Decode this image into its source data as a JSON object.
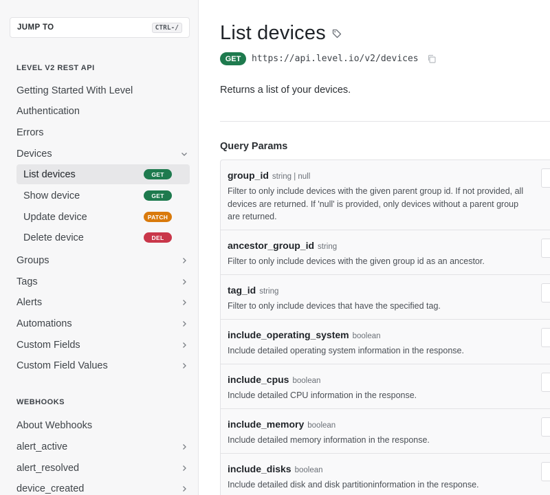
{
  "sidebar": {
    "jump_label": "JUMP TO",
    "jump_shortcut": "CTRL-/",
    "sections": [
      {
        "title": "LEVEL V2 REST API",
        "items": [
          {
            "label": "Getting Started With Level"
          },
          {
            "label": "Authentication"
          },
          {
            "label": "Errors"
          },
          {
            "label": "Devices",
            "expanded": true
          },
          {
            "label": "List devices",
            "method": "GET",
            "active": true
          },
          {
            "label": "Show device",
            "method": "GET"
          },
          {
            "label": "Update device",
            "method": "PATCH"
          },
          {
            "label": "Delete device",
            "method": "DEL"
          },
          {
            "label": "Groups"
          },
          {
            "label": "Tags"
          },
          {
            "label": "Alerts"
          },
          {
            "label": "Automations"
          },
          {
            "label": "Custom Fields"
          },
          {
            "label": "Custom Field Values"
          }
        ]
      },
      {
        "title": "WEBHOOKS",
        "items": [
          {
            "label": "About Webhooks"
          },
          {
            "label": "alert_active"
          },
          {
            "label": "alert_resolved"
          },
          {
            "label": "device_created"
          }
        ]
      }
    ]
  },
  "main": {
    "title": "List devices",
    "method": "GET",
    "url": "https://api.level.io/v2/devices",
    "description": "Returns a list of your devices.",
    "query_params_title": "Query Params",
    "params": [
      {
        "name": "group_id",
        "type": "string | null",
        "description": "Filter to only include devices with the given parent group id. If not provided, all devices are returned. If 'null' is provided, only devices without a parent group are returned."
      },
      {
        "name": "ancestor_group_id",
        "type": "string",
        "description": "Filter to only include devices with the given group id as an ancestor."
      },
      {
        "name": "tag_id",
        "type": "string",
        "description": "Filter to only include devices that have the specified tag."
      },
      {
        "name": "include_operating_system",
        "type": "boolean",
        "description": "Include detailed operating system information in the response."
      },
      {
        "name": "include_cpus",
        "type": "boolean",
        "description": "Include detailed CPU information in the response."
      },
      {
        "name": "include_memory",
        "type": "boolean",
        "description": "Include detailed memory information in the response."
      },
      {
        "name": "include_disks",
        "type": "boolean",
        "description": "Include detailed disk and disk partitioninformation in the response."
      }
    ]
  },
  "colors": {
    "get": "#1e7a4e",
    "patch": "#d97a0c",
    "del": "#c9374a"
  }
}
